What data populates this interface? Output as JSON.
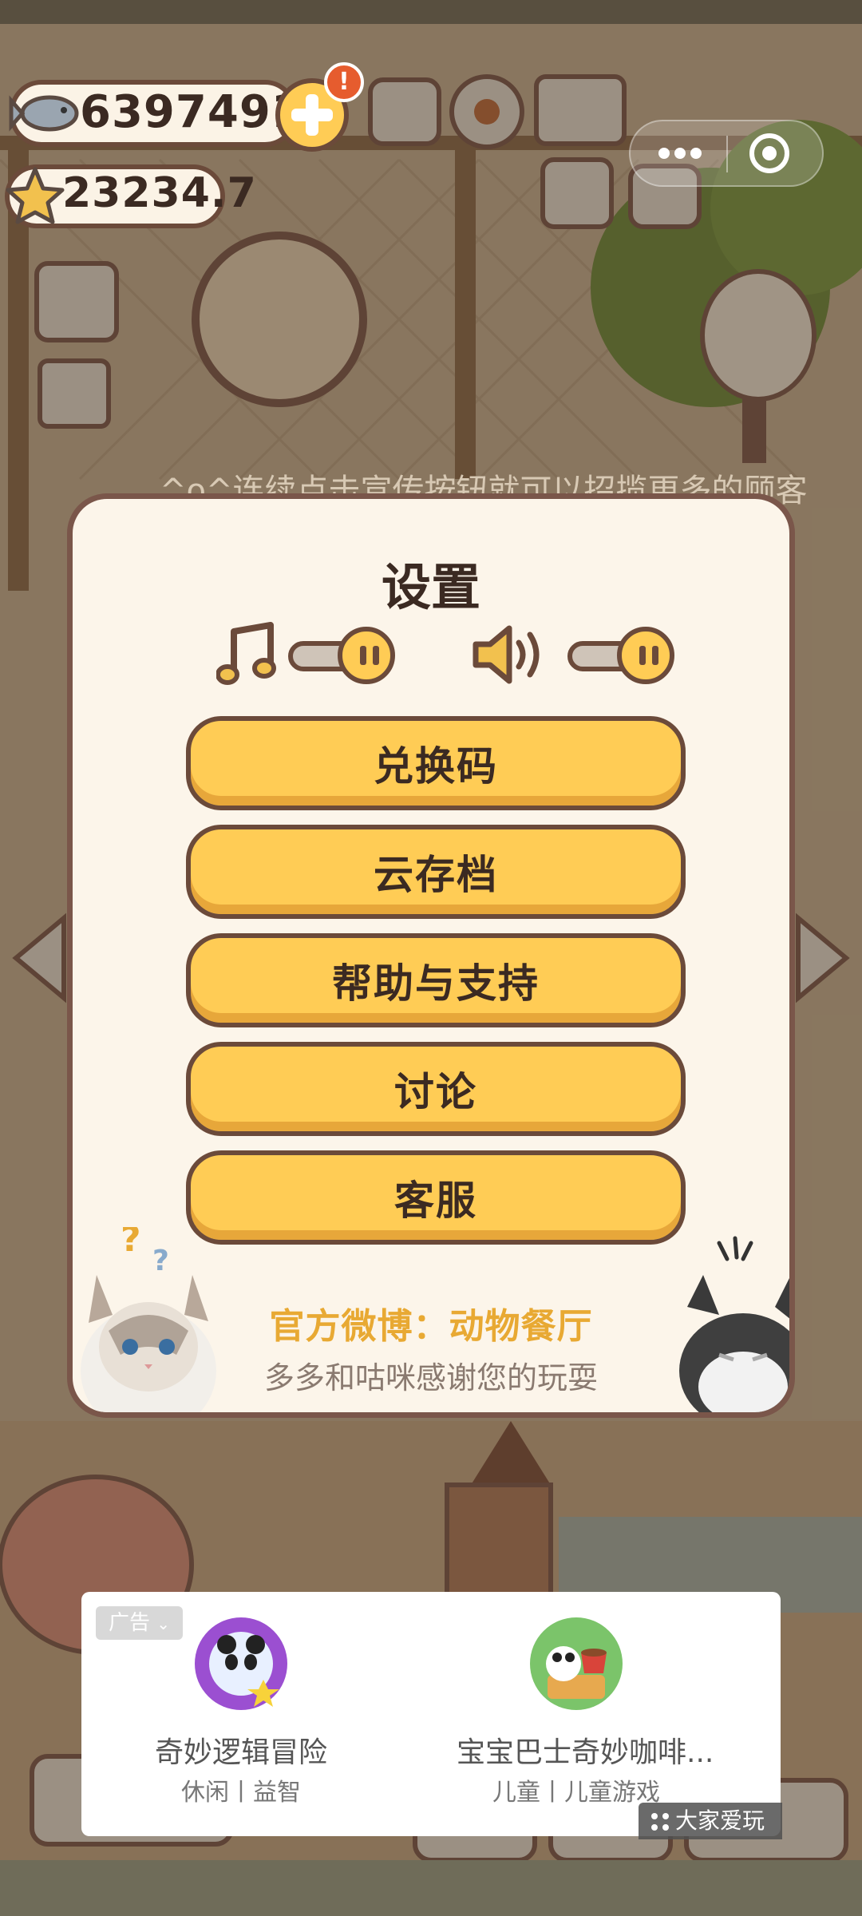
{
  "currency": {
    "fish": "6397491",
    "stars": "23234.7",
    "add_badge": "!"
  },
  "ticker_text": "^o^连续点击宣传按钮就可以招揽更多的顾客",
  "settings": {
    "title": "设置",
    "music_icon": "music-note-icon",
    "sound_icon": "speaker-icon",
    "buttons": [
      "兑换码",
      "云存档",
      "帮助与支持",
      "讨论",
      "客服"
    ],
    "footer_weibo": "官方微博：动物餐厅",
    "footer_thanks": "多多和咕咪感谢您的玩耍"
  },
  "ad": {
    "tag": "广告",
    "items": [
      {
        "name": "奇妙逻辑冒险",
        "category": "休闲丨益智"
      },
      {
        "name": "宝宝巴士奇妙咖啡...",
        "category": "儿童丨儿童游戏"
      }
    ],
    "brand": "大家爱玩"
  },
  "colors": {
    "panel_bg": "#fcf5ea",
    "button_fill": "#ffcc55",
    "border_brown": "#6b4a3a",
    "weibo_text": "#e8a933"
  }
}
